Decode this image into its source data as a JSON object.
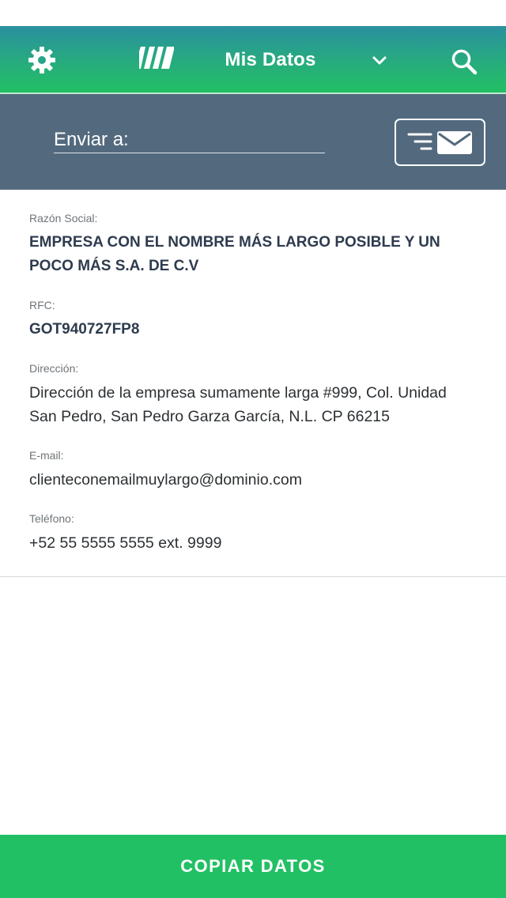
{
  "header": {
    "title": "Mis Datos",
    "icons": {
      "settings": "gear-icon",
      "logo": "brand-logo-icon",
      "dropdown": "chevron-down-icon",
      "search": "search-icon"
    }
  },
  "send_bar": {
    "label": "Enviar a:",
    "button_icons": [
      "filter-lines-icon",
      "envelope-icon"
    ]
  },
  "details": {
    "fields": [
      {
        "label": "Razón Social:",
        "value": "EMPRESA CON EL NOMBRE MÁS LARGO POSIBLE Y UN POCO MÁS S.A. DE C.V"
      },
      {
        "label": "RFC:",
        "value": "GOT940727FP8"
      },
      {
        "label": "Dirección:",
        "value": "Dirección de la empresa sumamente larga #999, Col. Unidad San Pedro, San Pedro Garza García, N.L. CP 66215"
      },
      {
        "label": "E-mail:",
        "value": "clienteconemailmuylargo@dominio.com"
      },
      {
        "label": "Teléfono:",
        "value": "+52 55 5555 5555 ext. 9999"
      }
    ]
  },
  "footer": {
    "copy_label": "COPIAR DATOS"
  },
  "colors": {
    "header_gradient_top": "#2a8fa0",
    "header_gradient_bottom": "#22c064",
    "send_bar": "#536a7e",
    "accent_green": "#22c065",
    "value_dark": "#2e3b4e"
  }
}
